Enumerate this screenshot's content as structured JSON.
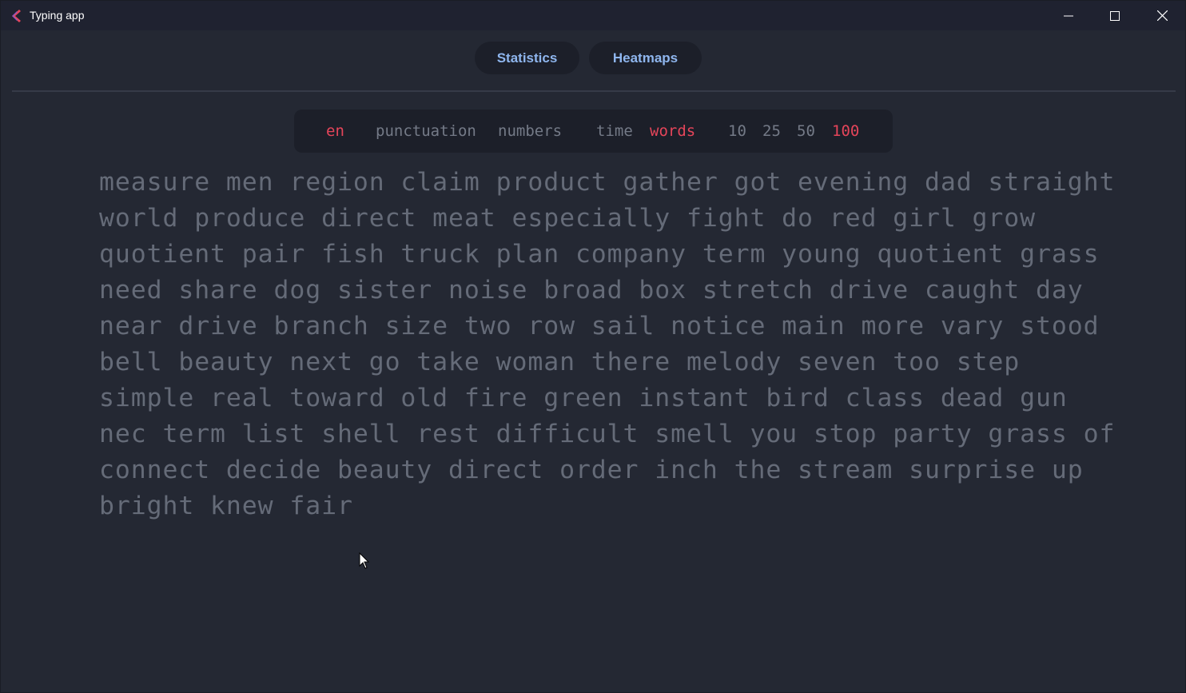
{
  "window": {
    "title": "Typing app",
    "minimize_icon": "minimize-icon",
    "maximize_icon": "maximize-icon",
    "close_icon": "close-icon"
  },
  "nav": {
    "statistics_label": "Statistics",
    "heatmaps_label": "Heatmaps"
  },
  "config": {
    "language": "en",
    "punctuation": "punctuation",
    "numbers": "numbers",
    "mode_time": "time",
    "mode_words": "words",
    "count_10": "10",
    "count_25": "25",
    "count_50": "50",
    "count_100": "100",
    "active_color": "#e5455a",
    "inactive_color": "#747a87"
  },
  "test": {
    "lines": [
      "measure men region claim product gather got evening dad straight",
      "world produce direct meat especially fight do red girl grow",
      "quotient pair fish truck plan company term young quotient grass",
      "need share dog sister noise broad box stretch drive caught day",
      "near drive branch size two row sail notice main more vary stood",
      "bell beauty next go take woman there melody seven too step",
      "simple real toward old fire green instant bird class dead gun",
      "nec term list shell rest difficult smell you stop party grass of",
      "connect decide beauty direct order inch the stream surprise up",
      "bright knew fair"
    ],
    "text_color": "#656b78"
  },
  "colors": {
    "background": "#242833",
    "titlebar": "#1f2230",
    "nav_text": "#8fb6ee"
  }
}
